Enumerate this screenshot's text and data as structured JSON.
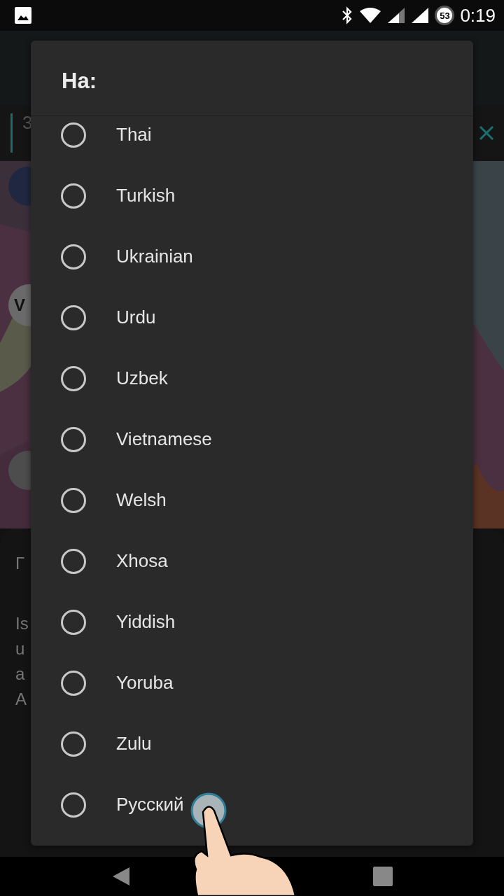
{
  "status_bar": {
    "time": "0:19",
    "battery": "53"
  },
  "background": {
    "header_fragment": "3",
    "avatar_letter": "V",
    "sheet_title_fragment": "Г",
    "sheet_text_fragments": [
      "Is",
      "u",
      "a",
      "A"
    ]
  },
  "dialog": {
    "title": "На:",
    "options": [
      {
        "label": "Thai",
        "selected": false
      },
      {
        "label": "Turkish",
        "selected": false
      },
      {
        "label": "Ukrainian",
        "selected": false
      },
      {
        "label": "Urdu",
        "selected": false
      },
      {
        "label": "Uzbek",
        "selected": false
      },
      {
        "label": "Vietnamese",
        "selected": false
      },
      {
        "label": "Welsh",
        "selected": false
      },
      {
        "label": "Xhosa",
        "selected": false
      },
      {
        "label": "Yiddish",
        "selected": false
      },
      {
        "label": "Yoruba",
        "selected": false
      },
      {
        "label": "Zulu",
        "selected": false
      },
      {
        "label": "Русский",
        "selected": false
      }
    ]
  }
}
